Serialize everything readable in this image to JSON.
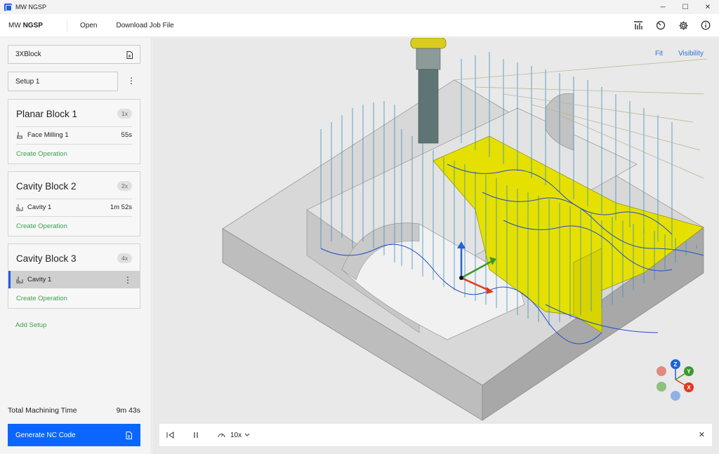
{
  "window": {
    "title": "MW NGSP",
    "minimize": "─",
    "maximize": "☐",
    "close": "✕"
  },
  "menubar": {
    "brand_prefix": "MW",
    "brand_name": "NGSP",
    "open_label": "Open",
    "download_label": "Download Job File",
    "icons": [
      "stats-icon",
      "history-icon",
      "settings-icon",
      "info-icon"
    ]
  },
  "sidebar": {
    "job_name": "3XBlock",
    "setup_name": "Setup 1",
    "setup_menu": "⋮",
    "blocks": [
      {
        "title": "Planar Block 1",
        "count": "1x",
        "operations": [
          {
            "name": "Face Milling 1",
            "time": "55s",
            "icon": "face-mill-icon",
            "selected": false
          }
        ],
        "create_label": "Create Operation"
      },
      {
        "title": "Cavity Block 2",
        "count": "2x",
        "operations": [
          {
            "name": "Cavity 1",
            "time": "1m 52s",
            "icon": "cavity-icon",
            "selected": false
          }
        ],
        "create_label": "Create Operation"
      },
      {
        "title": "Cavity Block 3",
        "count": "4x",
        "operations": [
          {
            "name": "Cavity 1",
            "time": "",
            "icon": "cavity-icon",
            "selected": true,
            "menu": "⋮"
          }
        ],
        "create_label": "Create Operation"
      }
    ],
    "add_setup_label": "Add Setup",
    "total_label": "Total Machining Time",
    "total_value": "9m 43s",
    "generate_label": "Generate NC Code"
  },
  "viewport": {
    "fit_label": "Fit",
    "visibility_label": "Visibility",
    "link_color": "#2d6fe0",
    "toolpath_color": "#3a8fc0",
    "highlight_color": "#e5e000",
    "playbar": {
      "speed": "10x",
      "close": "✕"
    },
    "gizmo": {
      "z": "Z",
      "y": "Y",
      "x": "X"
    }
  },
  "colors": {
    "accent": "#0a66ff",
    "link_green": "#3aa04e",
    "selected_bg": "#cfcfcf"
  }
}
